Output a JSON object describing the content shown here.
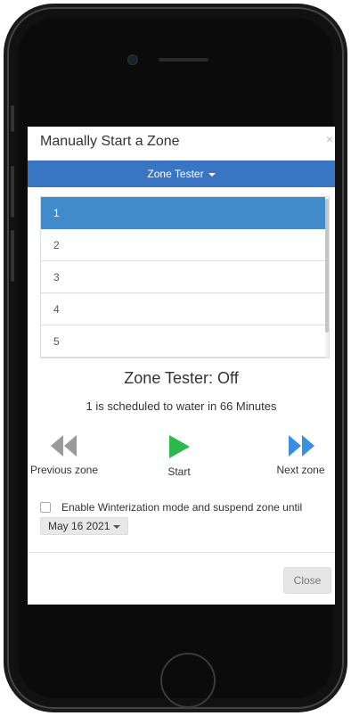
{
  "modal": {
    "title": "Manually Start a Zone",
    "close_symbol": "×"
  },
  "dropdown": {
    "label": "Zone Tester"
  },
  "zones": [
    {
      "label": "1"
    },
    {
      "label": "2"
    },
    {
      "label": "3"
    },
    {
      "label": "4"
    },
    {
      "label": "5"
    }
  ],
  "status": {
    "title": "Zone Tester: Off",
    "schedule": "1 is scheduled to water in 66 Minutes"
  },
  "controls": {
    "previous_label": "Previous zone",
    "start_label": "Start",
    "next_label": "Next zone"
  },
  "winterization": {
    "label": "Enable Winterization mode and suspend zone until",
    "date": "May 16 2021"
  },
  "footer": {
    "close_label": "Close"
  },
  "colors": {
    "accent": "#3a75c4",
    "active_item": "#428bca",
    "start_green": "#2db84d",
    "prev_gray": "#9a9a9a",
    "next_blue": "#3a8fe0"
  }
}
